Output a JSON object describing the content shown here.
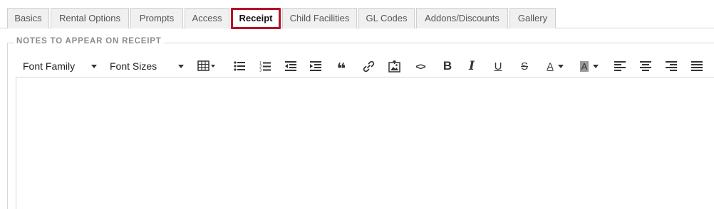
{
  "tabs": [
    {
      "label": "Basics",
      "active": false
    },
    {
      "label": "Rental Options",
      "active": false
    },
    {
      "label": "Prompts",
      "active": false
    },
    {
      "label": "Access",
      "active": false
    },
    {
      "label": "Receipt",
      "active": true
    },
    {
      "label": "Child Facilities",
      "active": false
    },
    {
      "label": "GL Codes",
      "active": false
    },
    {
      "label": "Addons/Discounts",
      "active": false
    },
    {
      "label": "Gallery",
      "active": false
    }
  ],
  "section": {
    "legend": "NOTES TO APPEAR ON RECEIPT"
  },
  "toolbar": {
    "font_family": "Font Family",
    "font_sizes": "Font Sizes",
    "bold": "B",
    "italic": "I",
    "underline": "U",
    "strike": "S",
    "text_color": "A",
    "highlight": "A",
    "quote": "❝",
    "code": "<>"
  },
  "editor": {
    "content": ""
  },
  "colors": {
    "active_tab_border": "#b5122b",
    "tab_bg": "#f0f0f0",
    "border": "#d6d6d6"
  }
}
